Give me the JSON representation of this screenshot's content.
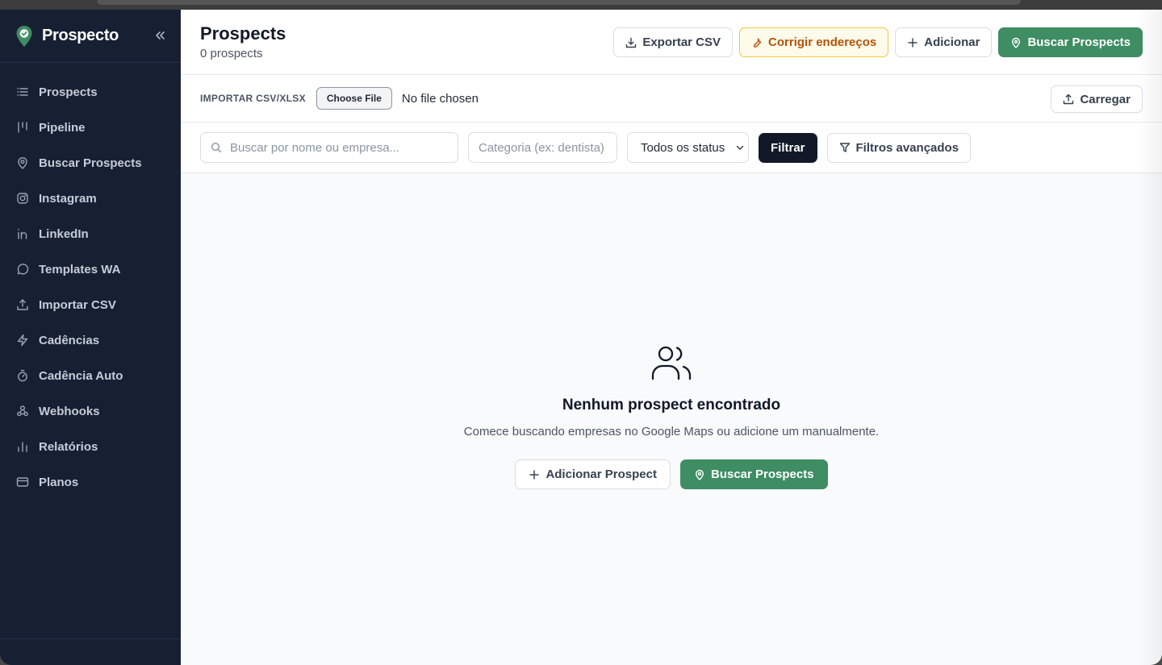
{
  "brand": {
    "name": "Prospecto",
    "accent": "#3e8d63"
  },
  "sidebar": {
    "items": [
      {
        "label": "Prospects",
        "icon": "list-icon"
      },
      {
        "label": "Pipeline",
        "icon": "pipeline-icon"
      },
      {
        "label": "Buscar Prospects",
        "icon": "map-pin-icon"
      },
      {
        "label": "Instagram",
        "icon": "instagram-icon"
      },
      {
        "label": "LinkedIn",
        "icon": "linkedin-icon"
      },
      {
        "label": "Templates WA",
        "icon": "message-circle-icon"
      },
      {
        "label": "Importar CSV",
        "icon": "upload-icon"
      },
      {
        "label": "Cadências",
        "icon": "zap-icon"
      },
      {
        "label": "Cadência Auto",
        "icon": "timer-icon"
      },
      {
        "label": "Webhooks",
        "icon": "webhook-icon"
      },
      {
        "label": "Relatórios",
        "icon": "bar-chart-icon"
      },
      {
        "label": "Planos",
        "icon": "credit-card-icon"
      }
    ]
  },
  "header": {
    "title": "Prospects",
    "count": "0 prospects",
    "export_label": "Exportar CSV",
    "fix_label": "Corrigir endereços",
    "add_label": "Adicionar",
    "search_label": "Buscar Prospects"
  },
  "import_bar": {
    "label": "IMPORTAR CSV/XLSX",
    "choose_file": "Choose File",
    "no_file": "No file chosen",
    "upload_label": "Carregar"
  },
  "filters": {
    "search_placeholder": "Buscar por nome ou empresa...",
    "category_placeholder": "Categoria (ex: dentista)",
    "status_selected": "Todos os status",
    "filter_label": "Filtrar",
    "advanced_label": "Filtros avançados"
  },
  "empty": {
    "title": "Nenhum prospect encontrado",
    "text": "Comece buscando empresas no Google Maps ou adicione um manualmente.",
    "add_label": "Adicionar Prospect",
    "search_label": "Buscar Prospects"
  }
}
